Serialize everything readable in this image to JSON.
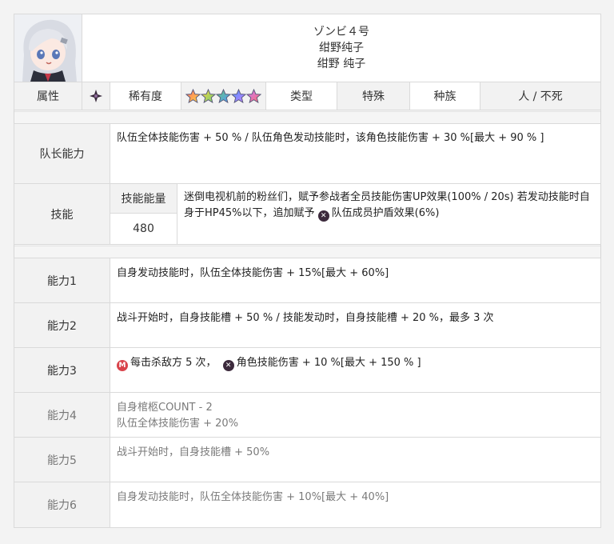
{
  "header": {
    "title_jp": "ゾンビ４号",
    "name_1": "绀野纯子",
    "name_2": "绀野 纯子",
    "avatar_icon": "zombie-girl-portrait"
  },
  "info_row": {
    "attribute_label": "属性",
    "attribute_icon": "dark-attribute-icon",
    "rarity_label": "稀有度",
    "rarity_stars": 5,
    "type_label": "类型",
    "type_value": "特殊",
    "race_label": "种族",
    "race_value": "人 / 不死"
  },
  "leader": {
    "label": "队长能力",
    "text": "队伍全体技能伤害 + 50 % / 队伍角色发动技能时，该角色技能伤害 + 30 %[最大 + 90 % ]"
  },
  "skill": {
    "label": "技能",
    "energy_label": "技能能量",
    "energy_value": "480",
    "text_1": "迷倒电视机前的粉丝们，赋予参战者全员技能伤害UP效果(100% / 20s) 若发动技能时自身于HP45%以下，追加赋予",
    "text_2": "队伍成员护盾效果(6%)",
    "shield_icon": "shield-badge-icon"
  },
  "abilities": [
    {
      "label": "能力1",
      "text": "自身发动技能时，队伍全体技能伤害 + 15%[最大 + 60%]"
    },
    {
      "label": "能力2",
      "text": "战斗开始时，自身技能槽 + 50 % / 技能发动时，自身技能槽 + 20 %，最多 3 次"
    },
    {
      "label": "能力3",
      "text_1": "每击杀敌方 5 次，",
      "text_2": "角色技能伤害 + 10 %[最大 + 150 % ]",
      "icon_1": "kill-badge-icon",
      "icon_2": "dark-badge-icon"
    },
    {
      "label": "能力4",
      "text_1": "自身棺柩COUNT - 2",
      "text_2": "队伍全体技能伤害 + 20%"
    },
    {
      "label": "能力5",
      "text": "战斗开始时，自身技能槽 + 50%"
    },
    {
      "label": "能力6",
      "text": "自身发动技能时，队伍全体技能伤害 + 10%[最大 + 40%]"
    }
  ],
  "colors": {
    "border": "#dadada",
    "attribute_icon": "#3a2b3d",
    "kill_icon": "#d9434b",
    "dark_icon": "#3c2a3c"
  }
}
